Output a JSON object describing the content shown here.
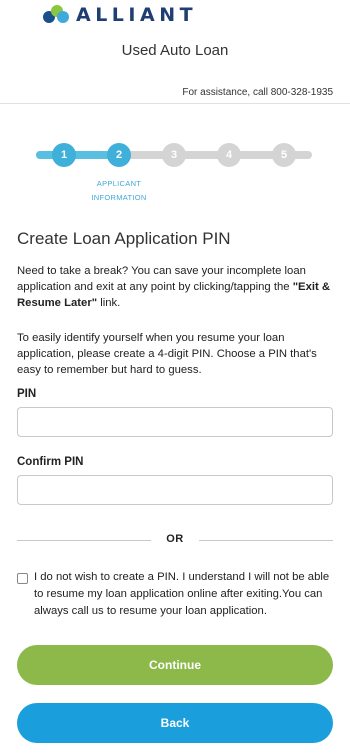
{
  "header": {
    "logo_text": "ALLIANT",
    "title": "Used Auto Loan",
    "assistance": "For assistance, call 800-328-1935"
  },
  "stepper": {
    "steps": [
      "1",
      "2",
      "3",
      "4",
      "5"
    ],
    "current_step": 2,
    "caption_line1": "APPLICANT",
    "caption_line2": "INFORMATION"
  },
  "main": {
    "heading": "Create Loan Application PIN",
    "para1_pre": "Need to take a break? You can save your incomplete loan application and exit at any point by clicking/tapping the ",
    "para1_bold": "\"Exit & Resume Later\"",
    "para1_post": " link.",
    "para2": "To easily identify yourself when you resume your loan application, please create a 4-digit PIN. Choose a PIN that's easy to remember but hard to guess.",
    "pin_label": "PIN",
    "pin_value": "",
    "confirm_label": "Confirm PIN",
    "confirm_value": "",
    "or_text": "OR",
    "checkbox_label": "I do not wish to create a PIN. I understand I will not be able to resume my loan application online after exiting.You can always call us to resume your loan application.",
    "checkbox_checked": false
  },
  "buttons": {
    "continue": "Continue",
    "back": "Back"
  },
  "colors": {
    "brand_navy": "#1f3f73",
    "step_active": "#3fb0d9",
    "continue_green": "#8db84a",
    "back_blue": "#1a9edc"
  },
  "icons": {
    "field_icon": "key-icon"
  }
}
